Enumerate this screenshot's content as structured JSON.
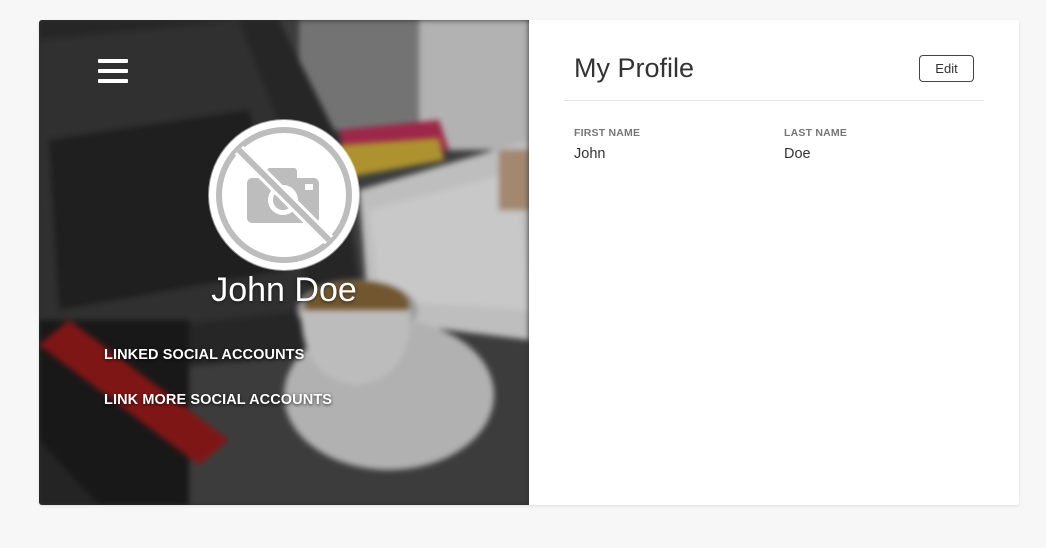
{
  "sidebar": {
    "menu_icon": "hamburger-menu-icon",
    "avatar_icon": "no-camera-icon",
    "user_name": "John Doe",
    "links": [
      {
        "label": "LINKED SOCIAL ACCOUNTS"
      },
      {
        "label": "LINK MORE SOCIAL ACCOUNTS"
      }
    ]
  },
  "profile": {
    "title": "My Profile",
    "edit_label": "Edit",
    "fields": [
      {
        "label": "FIRST NAME",
        "value": "John"
      },
      {
        "label": "LAST NAME",
        "value": "Doe"
      }
    ]
  },
  "colors": {
    "page_background": "#f7f7f7",
    "card_background": "#ffffff",
    "title_text": "#333333",
    "label_text": "#777777"
  }
}
